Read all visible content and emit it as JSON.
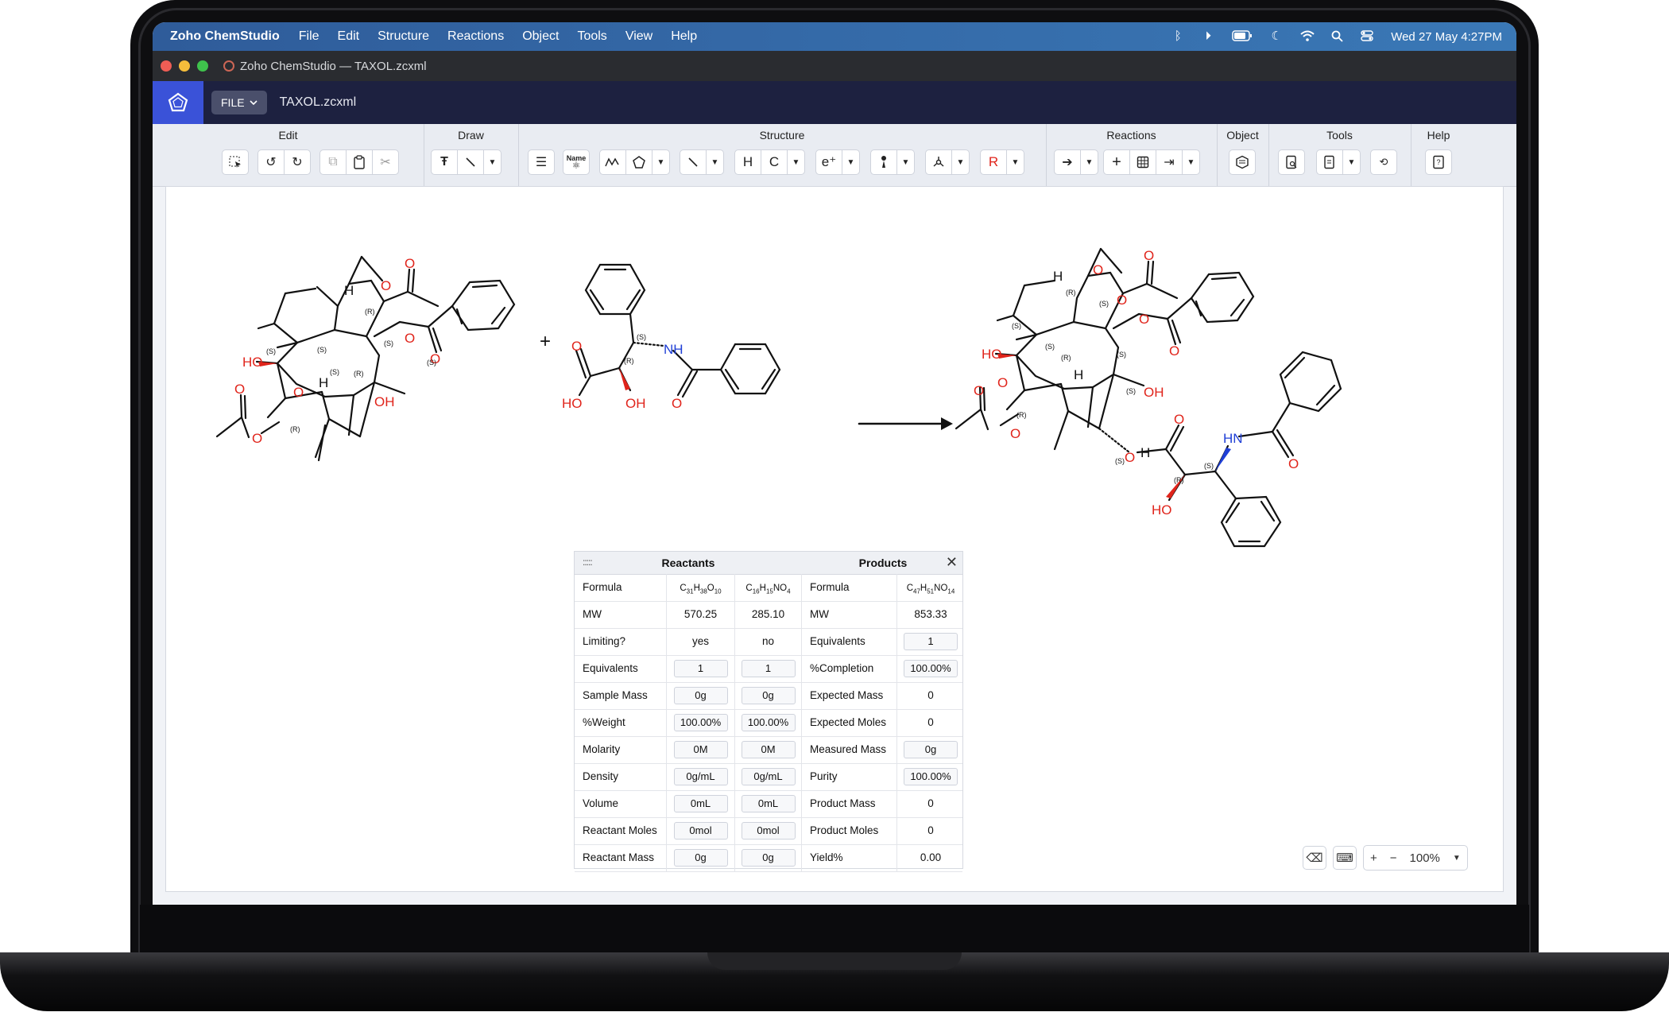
{
  "menubar": {
    "app_name": "Zoho ChemStudio",
    "items": [
      "File",
      "Edit",
      "Structure",
      "Reactions",
      "Object",
      "Tools",
      "View",
      "Help"
    ],
    "datetime": "Wed 27 May  4:27PM"
  },
  "window": {
    "title": "Zoho ChemStudio — TAXOL.zcxml"
  },
  "appbar": {
    "file_button": "FILE",
    "document": "TAXOL.zcxml"
  },
  "toolbar": {
    "groups": [
      "Edit",
      "Draw",
      "Structure",
      "Reactions",
      "Object",
      "Tools",
      "Help"
    ],
    "h_label": "H",
    "c_label": "C",
    "name_label": "Name",
    "e_label": "e⁺",
    "r_label": "R"
  },
  "reaction": {
    "plus": "+",
    "reactant1": {
      "labels": [
        "H",
        "O",
        "O",
        "O",
        "O",
        "HO",
        "O",
        "OH",
        "O",
        "O",
        "H"
      ],
      "stereo": [
        "(R)",
        "(S)",
        "(S)",
        "(S)",
        "(R)",
        "(S)",
        "(S)",
        "(R)"
      ]
    },
    "reactant2": {
      "labels": [
        "NH",
        "O",
        "HO",
        "OH",
        "O"
      ],
      "stereo": [
        "(S)",
        "(R)"
      ]
    },
    "product": {
      "labels": [
        "H",
        "O",
        "O",
        "O",
        "HO",
        "O",
        "O",
        "OH",
        "H",
        "O",
        "O",
        "O",
        "H",
        "O",
        "O",
        "HN",
        "O",
        "HO"
      ],
      "stereo": [
        "(R)",
        "(S)",
        "(S)",
        "(S)",
        "(R)",
        "(S)",
        "(S)",
        "(R)",
        "(S)",
        "(R)",
        "(S)"
      ]
    }
  },
  "panel": {
    "reactants_title": "Reactants",
    "products_title": "Products",
    "formula_r1": {
      "parts": [
        "C",
        "31",
        "H",
        "38",
        "O",
        "10"
      ]
    },
    "formula_r2": {
      "parts": [
        "C",
        "16",
        "H",
        "15",
        "NO",
        "4"
      ]
    },
    "formula_p": {
      "parts": [
        "C",
        "47",
        "H",
        "51",
        "NO",
        "14"
      ]
    },
    "rows": [
      {
        "rlabel": "Formula",
        "r1": "",
        "r2": "",
        "plabel": "Formula",
        "p": ""
      },
      {
        "rlabel": "MW",
        "r1": "570.25",
        "r2": "285.10",
        "plabel": "MW",
        "p": "853.33"
      },
      {
        "rlabel": "Limiting?",
        "r1": "yes",
        "r2": "no",
        "plabel": "Equivalents",
        "p": "1"
      },
      {
        "rlabel": "Equivalents",
        "r1": "1",
        "r2": "1",
        "plabel": "%Completion",
        "p": "100.00%"
      },
      {
        "rlabel": "Sample Mass",
        "r1": "0g",
        "r2": "0g",
        "plabel": "Expected Mass",
        "p": "0"
      },
      {
        "rlabel": "%Weight",
        "r1": "100.00%",
        "r2": "100.00%",
        "plabel": "Expected Moles",
        "p": "0"
      },
      {
        "rlabel": "Molarity",
        "r1": "0M",
        "r2": "0M",
        "plabel": "Measured Mass",
        "p": "0g"
      },
      {
        "rlabel": "Density",
        "r1": "0g/mL",
        "r2": "0g/mL",
        "plabel": "Purity",
        "p": "100.00%"
      },
      {
        "rlabel": "Volume",
        "r1": "0mL",
        "r2": "0mL",
        "plabel": "Product Mass",
        "p": "0"
      },
      {
        "rlabel": "Reactant Moles",
        "r1": "0mol",
        "r2": "0mol",
        "plabel": "Product Moles",
        "p": "0"
      },
      {
        "rlabel": "Reactant Mass",
        "r1": "0g",
        "r2": "0g",
        "plabel": "Yield%",
        "p": "0.00"
      }
    ]
  },
  "zoom": {
    "level": "100%"
  },
  "colors": {
    "oxygen": "#e0241b",
    "nitrogen": "#1f3fd6",
    "accent": "#3a52d8"
  }
}
